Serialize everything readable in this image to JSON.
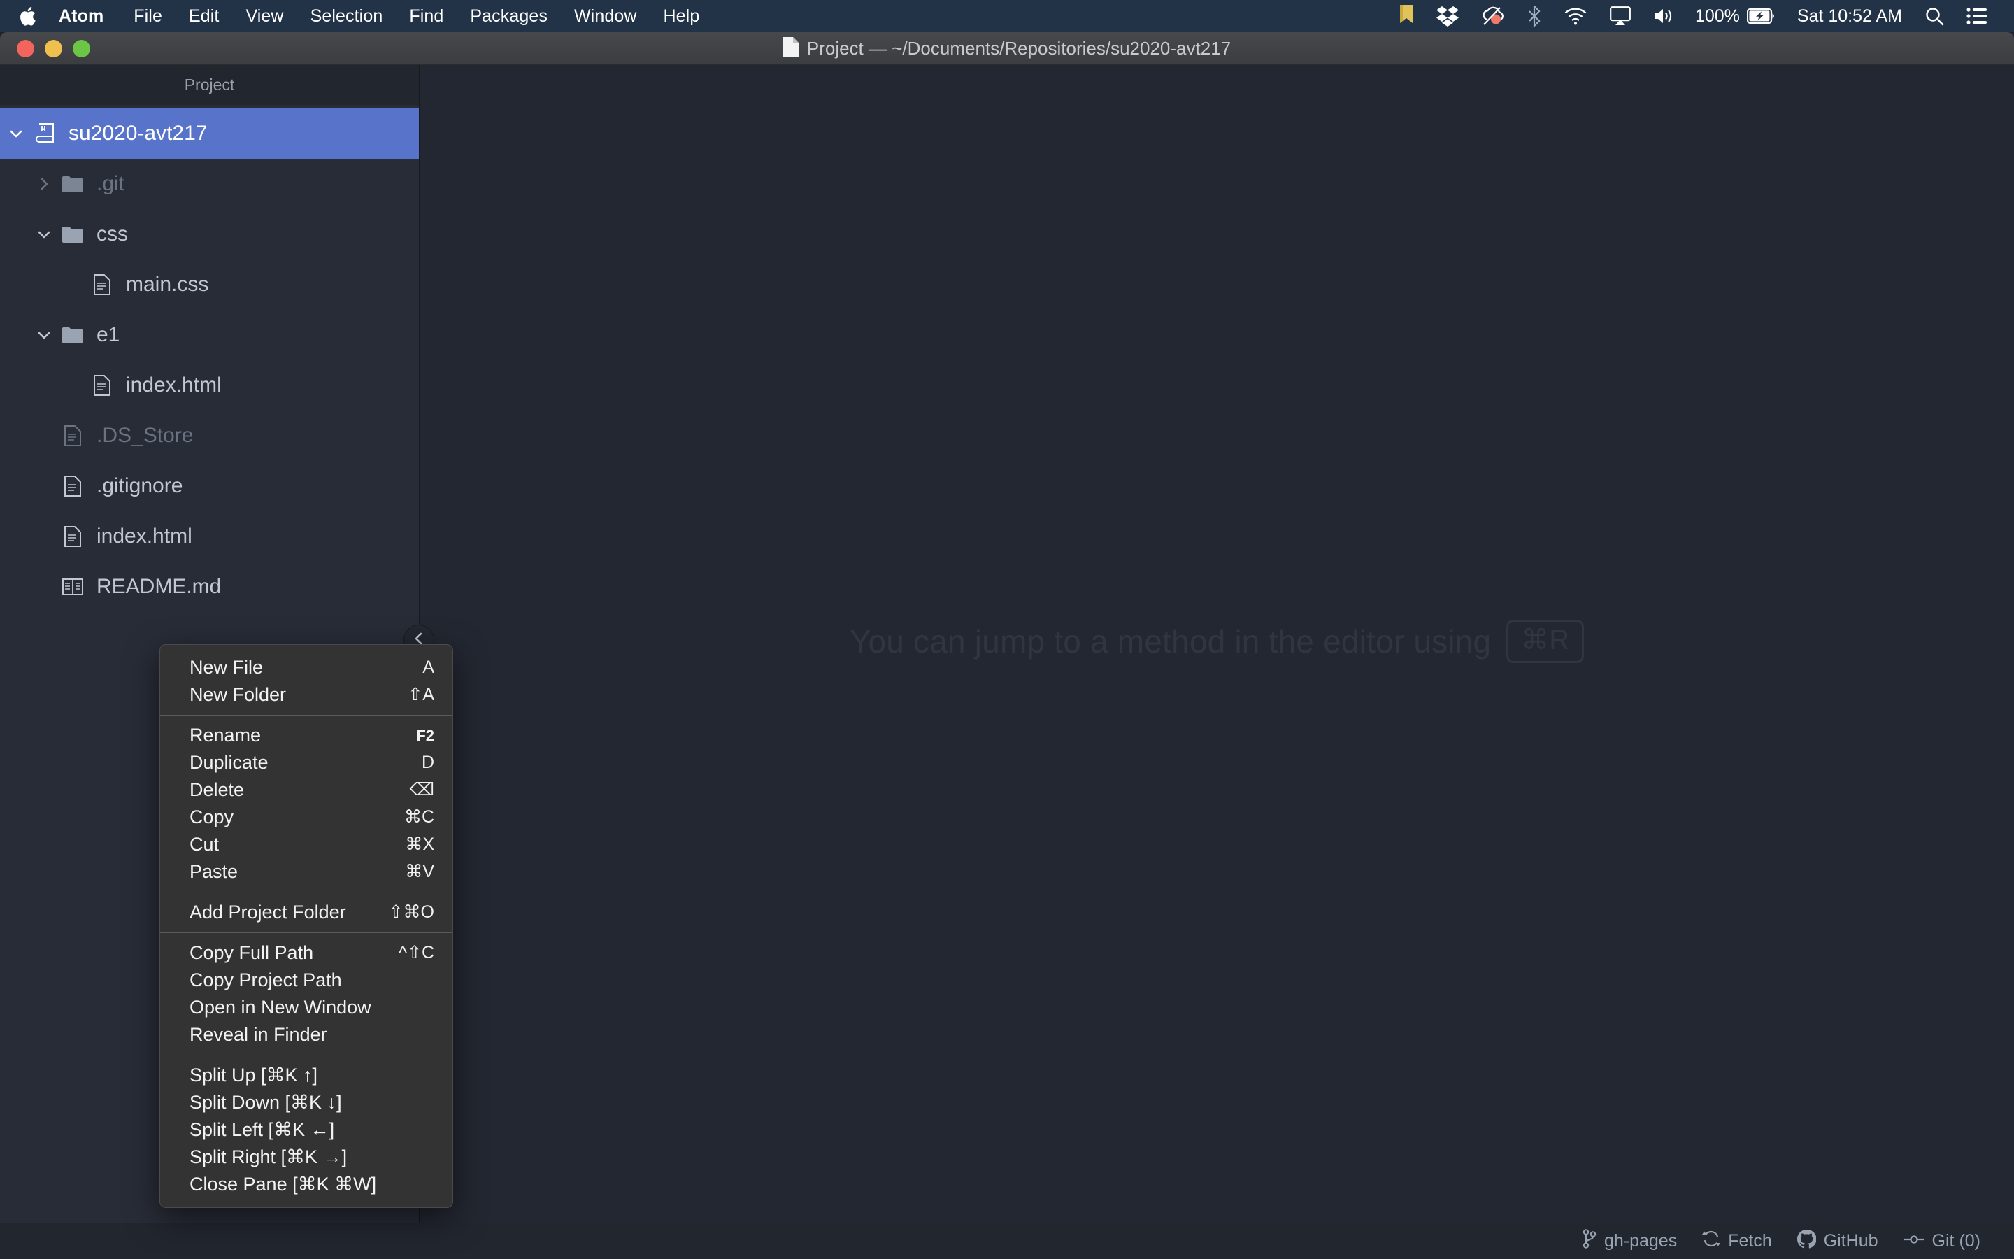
{
  "menubar": {
    "apple_icon": "apple-logo-icon",
    "items": [
      {
        "label": "Atom",
        "bold": true
      },
      {
        "label": "File",
        "bold": false
      },
      {
        "label": "Edit",
        "bold": false
      },
      {
        "label": "View",
        "bold": false
      },
      {
        "label": "Selection",
        "bold": false
      },
      {
        "label": "Find",
        "bold": false
      },
      {
        "label": "Packages",
        "bold": false
      },
      {
        "label": "Window",
        "bold": false
      },
      {
        "label": "Help",
        "bold": false
      }
    ],
    "status": {
      "bookmark_icon": "bookmark-icon",
      "dropbox_icon": "dropbox-icon",
      "cloud_icon": "cloud-app-icon",
      "bluetooth_icon": "bluetooth-icon",
      "wifi_icon": "wifi-icon",
      "airplay_icon": "airplay-icon",
      "volume_icon": "volume-icon",
      "battery_percent": "100%",
      "battery_icon": "battery-charging-icon",
      "clock": "Sat 10:52 AM",
      "search_icon": "search-icon",
      "control_center_icon": "control-center-icon"
    }
  },
  "window": {
    "traffic_lights": [
      "close-button",
      "minimize-button",
      "zoom-button"
    ],
    "title": "Project — ~/Documents/Repositories/su2020-avt217",
    "title_icon": "document-icon"
  },
  "treeview": {
    "header": "Project",
    "collapse_handle_icon": "chevron-left-icon",
    "items": [
      {
        "label": "su2020-avt217",
        "icon": "repo-icon",
        "depth": 0,
        "twisty": "chevron-down",
        "selected": true,
        "dim": false
      },
      {
        "label": ".git",
        "icon": "folder-icon",
        "depth": 1,
        "twisty": "chevron-right",
        "selected": false,
        "dim": true
      },
      {
        "label": "css",
        "icon": "folder-icon",
        "depth": 1,
        "twisty": "chevron-down",
        "selected": false,
        "dim": false
      },
      {
        "label": "main.css",
        "icon": "file-icon",
        "depth": 2,
        "twisty": "",
        "selected": false,
        "dim": false
      },
      {
        "label": "e1",
        "icon": "folder-icon",
        "depth": 1,
        "twisty": "chevron-down",
        "selected": false,
        "dim": false
      },
      {
        "label": "index.html",
        "icon": "file-icon",
        "depth": 2,
        "twisty": "",
        "selected": false,
        "dim": false
      },
      {
        "label": ".DS_Store",
        "icon": "file-icon",
        "depth": 1,
        "twisty": "",
        "selected": false,
        "dim": true
      },
      {
        "label": ".gitignore",
        "icon": "file-icon",
        "depth": 1,
        "twisty": "",
        "selected": false,
        "dim": false
      },
      {
        "label": "index.html",
        "icon": "file-icon",
        "depth": 1,
        "twisty": "",
        "selected": false,
        "dim": false
      },
      {
        "label": "README.md",
        "icon": "book-icon",
        "depth": 1,
        "twisty": "",
        "selected": false,
        "dim": false
      }
    ]
  },
  "editor": {
    "hint_text": "You can jump to a method in the editor using",
    "hint_key": "⌘R"
  },
  "statusbar": {
    "items": [
      {
        "label": "gh-pages",
        "icon": "git-branch-icon"
      },
      {
        "label": "Fetch",
        "icon": "sync-icon"
      },
      {
        "label": "GitHub",
        "icon": "github-mark-icon"
      },
      {
        "label": "Git (0)",
        "icon": "git-commit-icon"
      }
    ]
  },
  "context_menu": {
    "groups": [
      [
        {
          "label": "New File",
          "key": "A",
          "small": false
        },
        {
          "label": "New Folder",
          "key": "⇧A",
          "small": false
        }
      ],
      [
        {
          "label": "Rename",
          "key": "F2",
          "small": true
        },
        {
          "label": "Duplicate",
          "key": "D",
          "small": false
        },
        {
          "label": "Delete",
          "key": "⌫",
          "small": false
        },
        {
          "label": "Copy",
          "key": "⌘C",
          "small": false
        },
        {
          "label": "Cut",
          "key": "⌘X",
          "small": false
        },
        {
          "label": "Paste",
          "key": "⌘V",
          "small": false
        }
      ],
      [
        {
          "label": "Add Project Folder",
          "key": "⇧⌘O",
          "small": false
        }
      ],
      [
        {
          "label": "Copy Full Path",
          "key": "^⇧C",
          "small": false
        },
        {
          "label": "Copy Project Path",
          "key": "",
          "small": false
        },
        {
          "label": "Open in New Window",
          "key": "",
          "small": false
        },
        {
          "label": "Reveal in Finder",
          "key": "",
          "small": false
        }
      ],
      [
        {
          "label": "Split Up [⌘K ↑]",
          "key": "",
          "small": false
        },
        {
          "label": "Split Down [⌘K ↓]",
          "key": "",
          "small": false
        },
        {
          "label": "Split Left [⌘K ←]",
          "key": "",
          "small": false
        },
        {
          "label": "Split Right [⌘K →]",
          "key": "",
          "small": false
        },
        {
          "label": "Close Pane [⌘K ⌘W]",
          "key": "",
          "small": false
        }
      ]
    ]
  },
  "colors": {
    "menubar_bg": "#223247",
    "titlebar_bg": "#3e4043",
    "tree_bg": "#282c37",
    "editor_bg": "#232731",
    "selection_blue": "#5874ca",
    "context_menu_bg": "#333333",
    "status_text": "#9aa3b2"
  }
}
